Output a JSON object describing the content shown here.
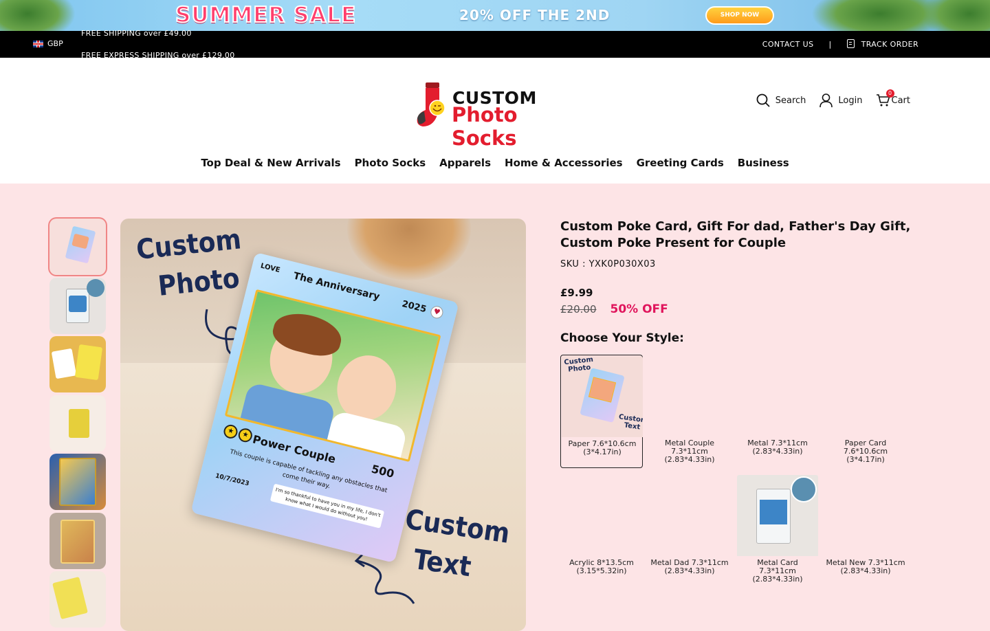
{
  "promo_banner": {
    "sale_text": "SUMMER SALE",
    "offer_text": "20% OFF THE 2ND",
    "shop_button": "SHOP NOW"
  },
  "topbar": {
    "currency": "GBP",
    "shipping_messages": [
      "FREE SHIPPING over £49.00",
      "FREE EXPRESS SHIPPING over £129.00"
    ],
    "contact": "CONTACT US",
    "separator": "|",
    "track": "TRACK ORDER"
  },
  "header": {
    "logo_line1": "CUSTOM",
    "logo_line2": "Photo Socks",
    "search_label": "Search",
    "login_label": "Login",
    "cart_label": "Cart",
    "cart_count": "0"
  },
  "nav": [
    "Top Deal & New Arrivals",
    "Photo Socks",
    "Apparels",
    "Home & Accessories",
    "Greeting Cards",
    "Business"
  ],
  "product": {
    "title": "Custom Poke Card, Gift For dad, Father's Day Gift, Custom Poke Present for Couple",
    "sku": "SKU : YXK0P030X03",
    "price": "£9.99",
    "old_price": "£20.00",
    "discount": "50% OFF",
    "choose_label": "Choose Your Style:"
  },
  "main_image": {
    "overlay_top": [
      "Custom",
      "Photo"
    ],
    "overlay_bottom": [
      "Custom",
      "Text"
    ],
    "card_label": "LOVE",
    "card_title": "The Anniversary",
    "card_year": "2025",
    "card_name": "Power Couple",
    "card_power": "500",
    "card_desc": "This couple is capable of tackling any obstacles that come their way.",
    "card_date": "10/7/2023",
    "card_quote": "I'm so thankful to have you in my life, I don't know what I would do without you!",
    "mini_overlay_top": [
      "Custom",
      "Photo"
    ],
    "mini_overlay_bottom": [
      "Custom",
      "Text"
    ]
  },
  "styles": [
    {
      "label": "Paper 7.6*10.6cm (3*4.17in)",
      "selected": true
    },
    {
      "label": "Metal Couple 7.3*11cm (2.83*4.33in)"
    },
    {
      "label": "Metal 7.3*11cm (2.83*4.33in)"
    },
    {
      "label": "Paper Card 7.6*10.6cm (3*4.17in)"
    },
    {
      "label": "Acrylic 8*13.5cm (3.15*5.32in)"
    },
    {
      "label": "Metal Dad 7.3*11cm (2.83*4.33in)"
    },
    {
      "label": "Metal Card 7.3*11cm (2.83*4.33in)"
    },
    {
      "label": "Metal New 7.3*11cm (2.83*4.33in)"
    }
  ],
  "colors": {
    "accent_red": "#e31d2e",
    "discount_pink": "#e0155c",
    "page_bg": "#fde4e6"
  }
}
